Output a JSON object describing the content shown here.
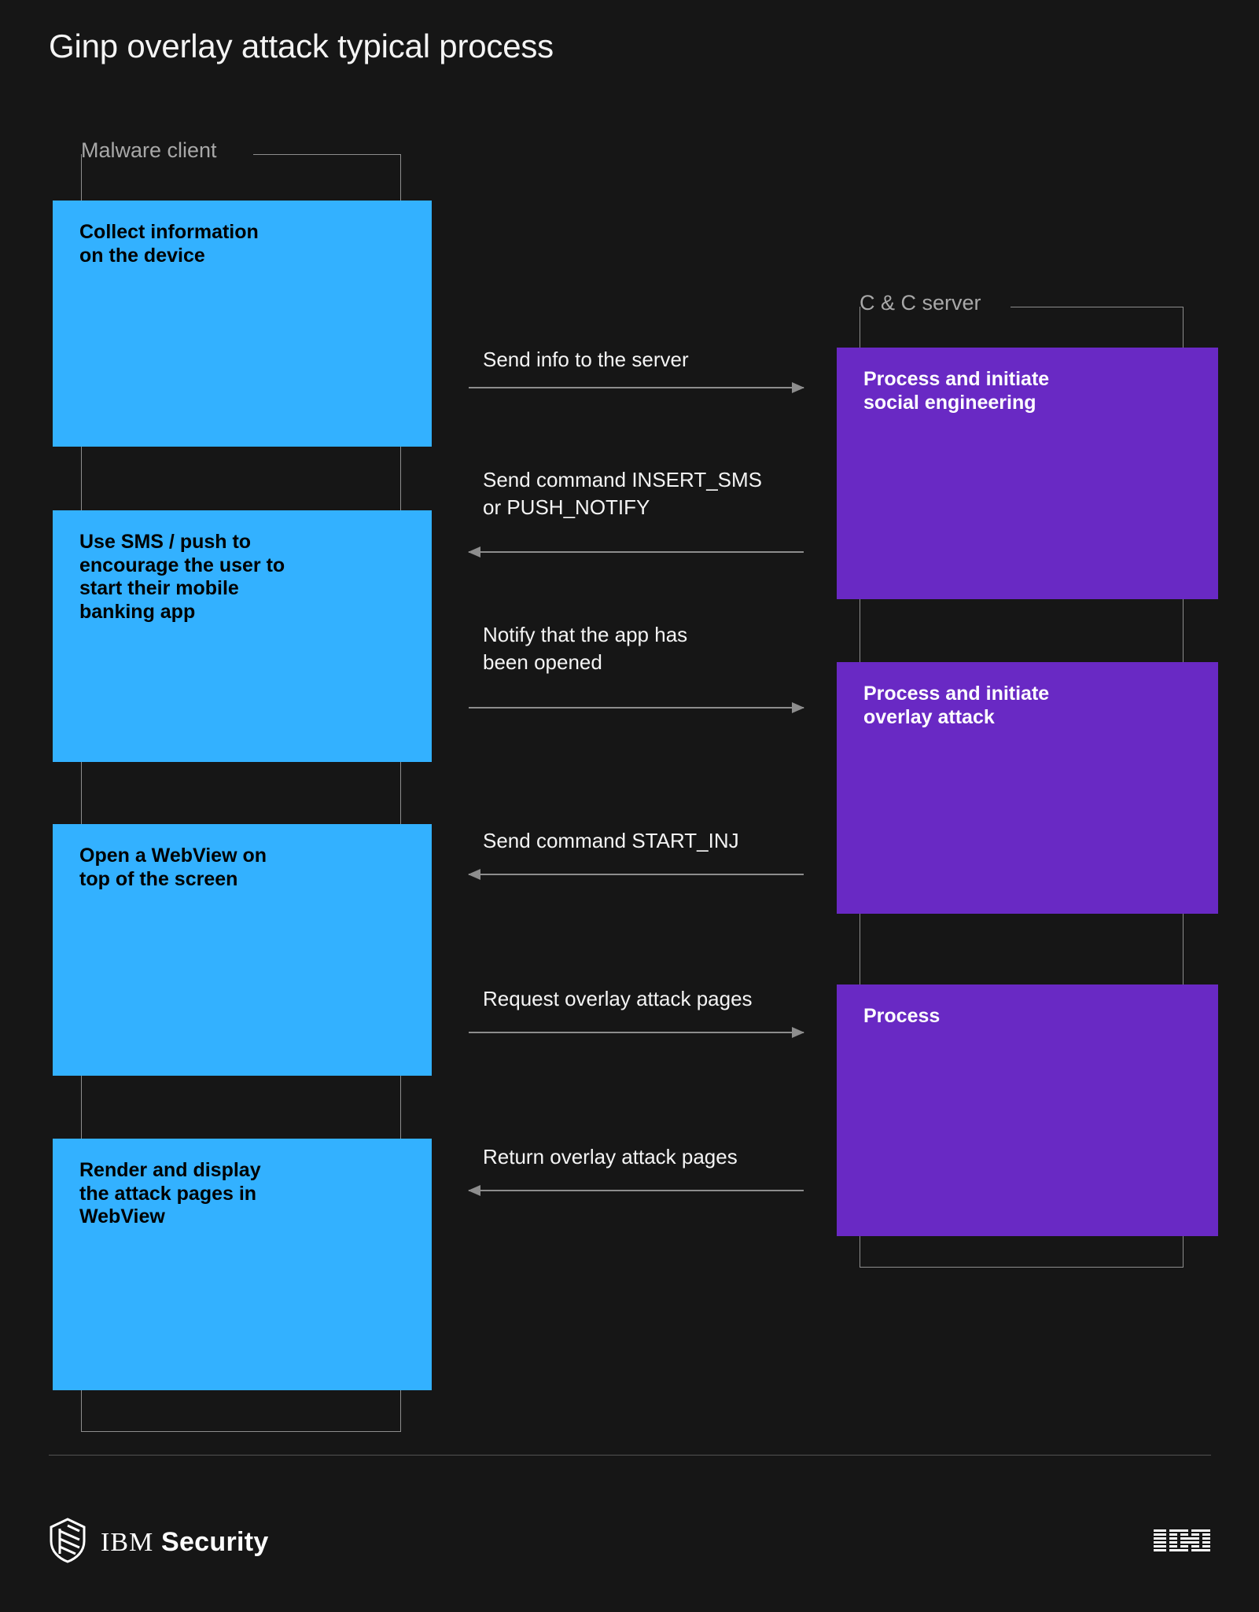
{
  "title": "Ginp overlay attack typical process",
  "colors": {
    "background": "#161616",
    "client_box": "#33b1ff",
    "server_box": "#6929c4",
    "line": "#8d8d8d",
    "lane_label": "#a8a8a8",
    "text_light": "#f4f4f4"
  },
  "lanes": [
    {
      "id": "client",
      "label": "Malware client"
    },
    {
      "id": "server",
      "label": "C & C server"
    }
  ],
  "client_steps": [
    {
      "id": "collect-information",
      "text": "Collect information\non the device"
    },
    {
      "id": "use-sms-push",
      "text": "Use SMS / push to\nencourage the user to\nstart their mobile\nbanking app"
    },
    {
      "id": "open-webview",
      "text": "Open a WebView on\ntop of the screen"
    },
    {
      "id": "render-display",
      "text": "Render and display\nthe attack pages in\nWebView"
    }
  ],
  "server_steps": [
    {
      "id": "process-social-engineering",
      "text": "Process and initiate\nsocial engineering"
    },
    {
      "id": "process-overlay-attack",
      "text": "Process and initiate\noverlay attack"
    },
    {
      "id": "process",
      "text": "Process"
    }
  ],
  "messages": [
    {
      "id": "send-info",
      "label": "Send info to the server",
      "direction": "right"
    },
    {
      "id": "send-command-insert-sms",
      "label": "Send command INSERT_SMS\nor PUSH_NOTIFY",
      "direction": "left"
    },
    {
      "id": "notify-app-opened",
      "label": "Notify that the app has\nbeen opened",
      "direction": "right"
    },
    {
      "id": "send-command-start-inj",
      "label": "Send command  START_INJ",
      "direction": "left"
    },
    {
      "id": "request-overlay-pages",
      "label": "Request overlay attack pages",
      "direction": "right"
    },
    {
      "id": "return-overlay-pages",
      "label": "Return overlay attack pages",
      "direction": "left"
    }
  ],
  "footer": {
    "brand_prefix": "IBM",
    "brand_suffix": "Security",
    "logo_icon": "shield-icon",
    "corporate_mark": "IBM"
  }
}
